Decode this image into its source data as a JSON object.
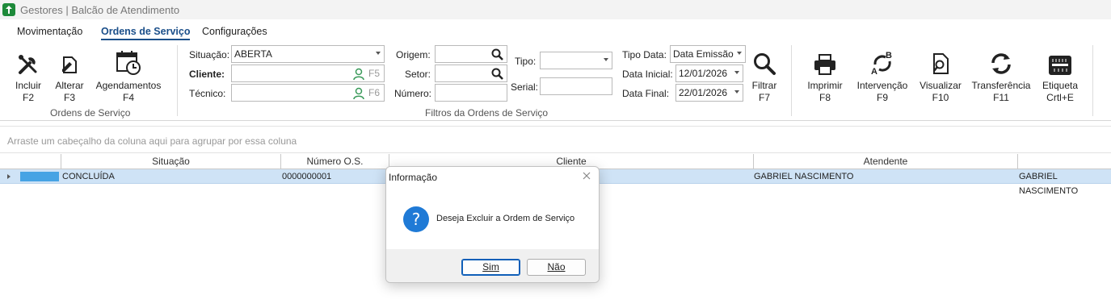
{
  "window": {
    "title": "Gestores |  Balcão de Atendimento"
  },
  "menu": {
    "items": [
      "Movimentação",
      "Ordens de Serviço",
      "Configurações"
    ],
    "active": "Ordens de Serviço"
  },
  "ribbon": {
    "actions": [
      {
        "label": "Incluir",
        "key": "F2",
        "icon": "tools-icon"
      },
      {
        "label": "Alterar",
        "key": "F3",
        "icon": "edit-document-icon"
      },
      {
        "label": "Agendamentos",
        "key": "F4",
        "icon": "calendar-clock-icon"
      }
    ],
    "actions_group_label": "Ordens de Serviço",
    "filters_group_label": "Filtros da Ordens de Serviço",
    "filters": {
      "situacao_label": "Situação:",
      "situacao_value": "ABERTA",
      "cliente_label": "Cliente:",
      "cliente_key": "F5",
      "tecnico_label": "Técnico:",
      "tecnico_key": "F6",
      "origem_label": "Origem:",
      "setor_label": "Setor:",
      "numero_label": "Número:",
      "tipo_label": "Tipo:",
      "serial_label": "Serial:",
      "tipo_data_label": "Tipo Data:",
      "tipo_data_value": "Data Emissão",
      "data_inicial_label": "Data Inicial:",
      "data_inicial_value": "12/01/2026",
      "data_final_label": "Data Final:",
      "data_final_value": "22/01/2026"
    },
    "filter_button": {
      "label": "Filtrar",
      "key": "F7",
      "icon": "magnifier-icon"
    },
    "tools": [
      {
        "label": "Imprimir",
        "key": "F8",
        "icon": "printer-icon"
      },
      {
        "label": "Intervenção",
        "key": "F9",
        "icon": "swap-ab-icon"
      },
      {
        "label": "Visualizar",
        "key": "F10",
        "icon": "preview-icon"
      },
      {
        "label": "Transferência",
        "key": "F11",
        "icon": "refresh-icon"
      },
      {
        "label": "Etiqueta",
        "key": "Crtl+E",
        "icon": "barcode-label-icon"
      }
    ]
  },
  "grid": {
    "group_hint": "Arraste um cabeçalho da coluna aqui para agrupar por essa coluna",
    "columns": [
      "Situação",
      "Número O.S.",
      "Cliente",
      "Atendente"
    ],
    "rows": [
      {
        "situacao": "CONCLUÍDA",
        "numero": "0000000001",
        "cliente": "",
        "atendente": "GABRIEL NASCIMENTO",
        "extra": "GABRIEL NASCIMENTO",
        "status_color": "#46a3e4"
      }
    ]
  },
  "dialog": {
    "title": "Informação",
    "message": "Deseja Excluir a Ordem de Serviço",
    "yes": "Sim",
    "no": "Não",
    "icon": "question-icon"
  }
}
